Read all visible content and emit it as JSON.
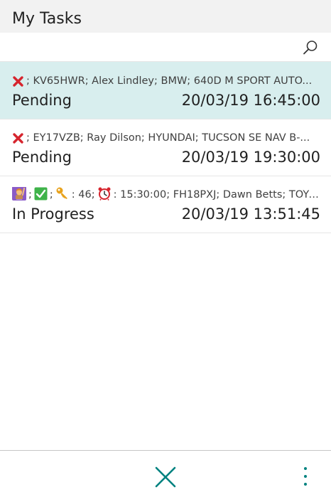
{
  "app": {
    "title": "My Tasks"
  },
  "search": {
    "icon": "search-icon"
  },
  "tasks": [
    {
      "summary": "; KV65HWR; Alex Lindley; BMW; 640D M SPORT AUTO...",
      "status": "Pending",
      "datetime": "20/03/19 16:45:00",
      "selected": true,
      "icons": [
        "cross-mark-icon"
      ]
    },
    {
      "summary": "; EY17VZB; Ray Dilson; HYUNDAI; TUCSON SE NAV B-...",
      "status": "Pending",
      "datetime": "20/03/19 19:30:00",
      "selected": false,
      "icons": [
        "cross-mark-icon"
      ]
    },
    {
      "sep1": ";",
      "sep2": ";",
      "key_text": ": 46;",
      "summary": ": 15:30:00; FH18PXJ; Dawn Betts; TOYO...",
      "status": "In Progress",
      "datetime": "20/03/19 13:51:45",
      "selected": false,
      "icons": [
        "person-raising-hand-icon",
        "check-box-icon",
        "key-icon",
        "alarm-clock-icon"
      ]
    }
  ],
  "footer": {
    "close_icon": "close-icon",
    "more_icon": "more-vertical-icon"
  },
  "colors": {
    "selected_row": "#d8eeee",
    "accent": "#00827f",
    "cross": "#d6252e",
    "check": "#3fb34a"
  }
}
